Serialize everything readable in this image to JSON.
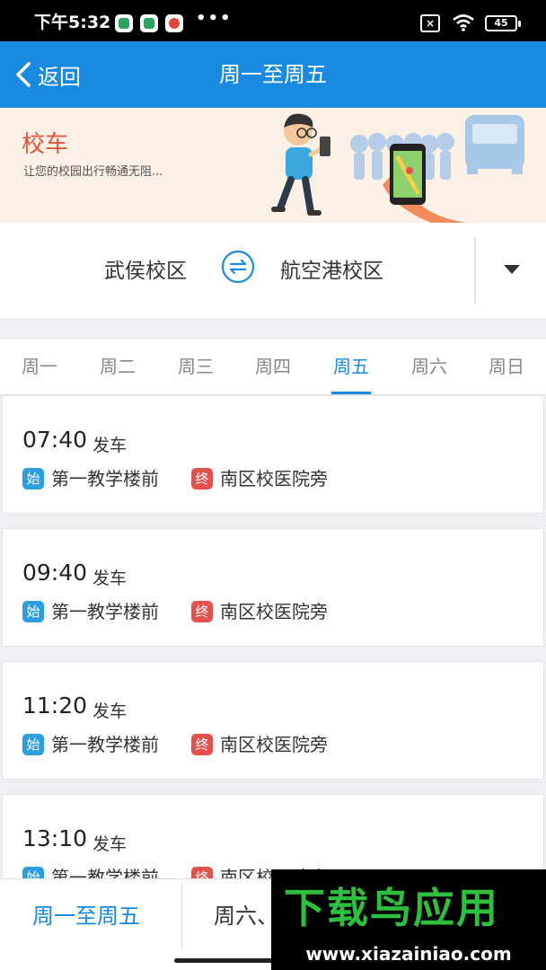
{
  "status_bar": {
    "time": "下午5:32",
    "battery": "45",
    "sim_icon": "sim-off-icon"
  },
  "nav": {
    "back_label": "返回",
    "title": "周一至周五"
  },
  "banner": {
    "title": "校车",
    "subtitle": "让您的校园出行畅通无阻..."
  },
  "route": {
    "from": "武侯校区",
    "to": "航空港校区"
  },
  "days": [
    "周一",
    "周二",
    "周三",
    "周四",
    "周五",
    "周六",
    "周日"
  ],
  "active_day": "周五",
  "trips": [
    {
      "time": "07:40",
      "suffix": "发车",
      "start_badge": "始",
      "start": "第一教学楼前",
      "end_badge": "终",
      "end": "南区校医院旁"
    },
    {
      "time": "09:40",
      "suffix": "发车",
      "start_badge": "始",
      "start": "第一教学楼前",
      "end_badge": "终",
      "end": "南区校医院旁"
    },
    {
      "time": "11:20",
      "suffix": "发车",
      "start_badge": "始",
      "start": "第一教学楼前",
      "end_badge": "终",
      "end": "南区校医院旁"
    },
    {
      "time": "13:10",
      "suffix": "发车",
      "start_badge": "始",
      "start": "第一教学楼前",
      "end_badge": "终",
      "end": "南区校医院旁"
    }
  ],
  "bottom_tabs": [
    "周一至周五",
    "周六、"
  ],
  "watermark": {
    "logo": "下载鸟应用",
    "url": "www.xiazainiao.com"
  },
  "colors": {
    "primary": "#1a8ae0",
    "start_badge": "#2b9ee0",
    "end_badge": "#e4514d",
    "banner_bg": "#faf0e6"
  }
}
